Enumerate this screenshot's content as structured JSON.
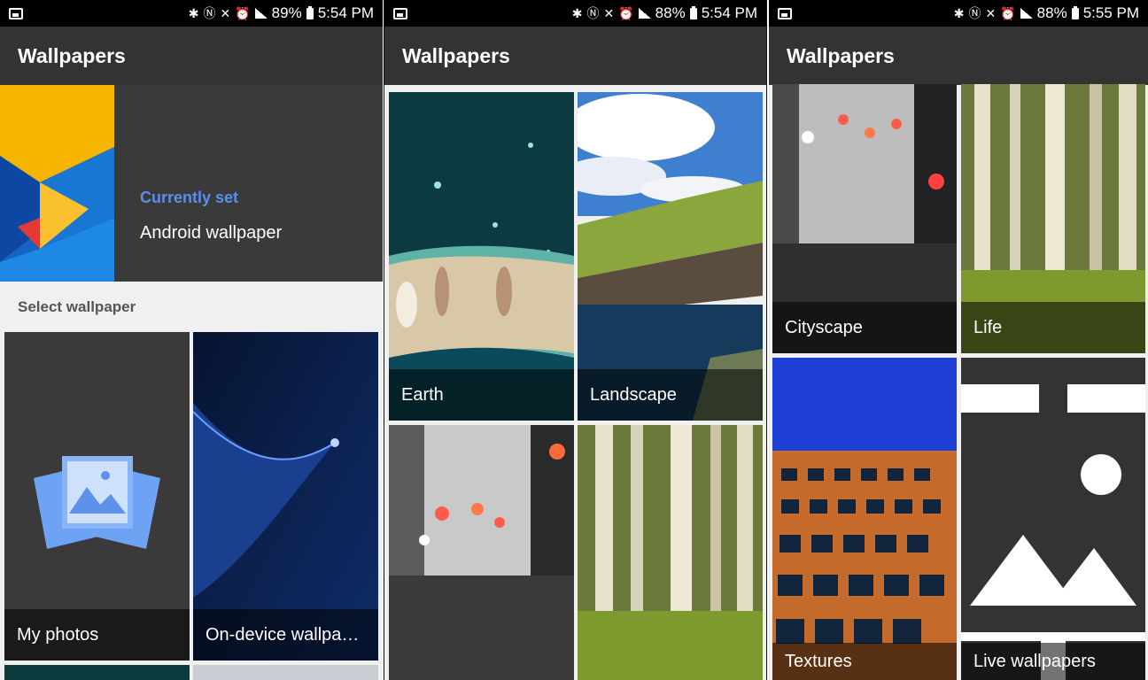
{
  "screens": [
    {
      "status": {
        "battery": "89%",
        "time": "5:54 PM"
      },
      "app_title": "Wallpapers",
      "current": {
        "label": "Currently set",
        "name": "Android wallpaper"
      },
      "section_label": "Select wallpaper",
      "tiles": [
        {
          "label": "My photos"
        },
        {
          "label": "On-device wallpa…"
        }
      ]
    },
    {
      "status": {
        "battery": "88%",
        "time": "5:54 PM"
      },
      "app_title": "Wallpapers",
      "tiles": [
        {
          "label": "Earth"
        },
        {
          "label": "Landscape"
        }
      ]
    },
    {
      "status": {
        "battery": "88%",
        "time": "5:55 PM"
      },
      "app_title": "Wallpapers",
      "tiles": [
        {
          "label": "Cityscape"
        },
        {
          "label": "Life"
        },
        {
          "label": "Textures"
        },
        {
          "label": "Live wallpapers"
        }
      ]
    }
  ],
  "icons": [
    "bluetooth-icon",
    "nfc-icon",
    "mute-icon",
    "alarm-icon",
    "4g-icon",
    "signal-icon",
    "battery-icon",
    "image-icon",
    "gallery-icon"
  ]
}
